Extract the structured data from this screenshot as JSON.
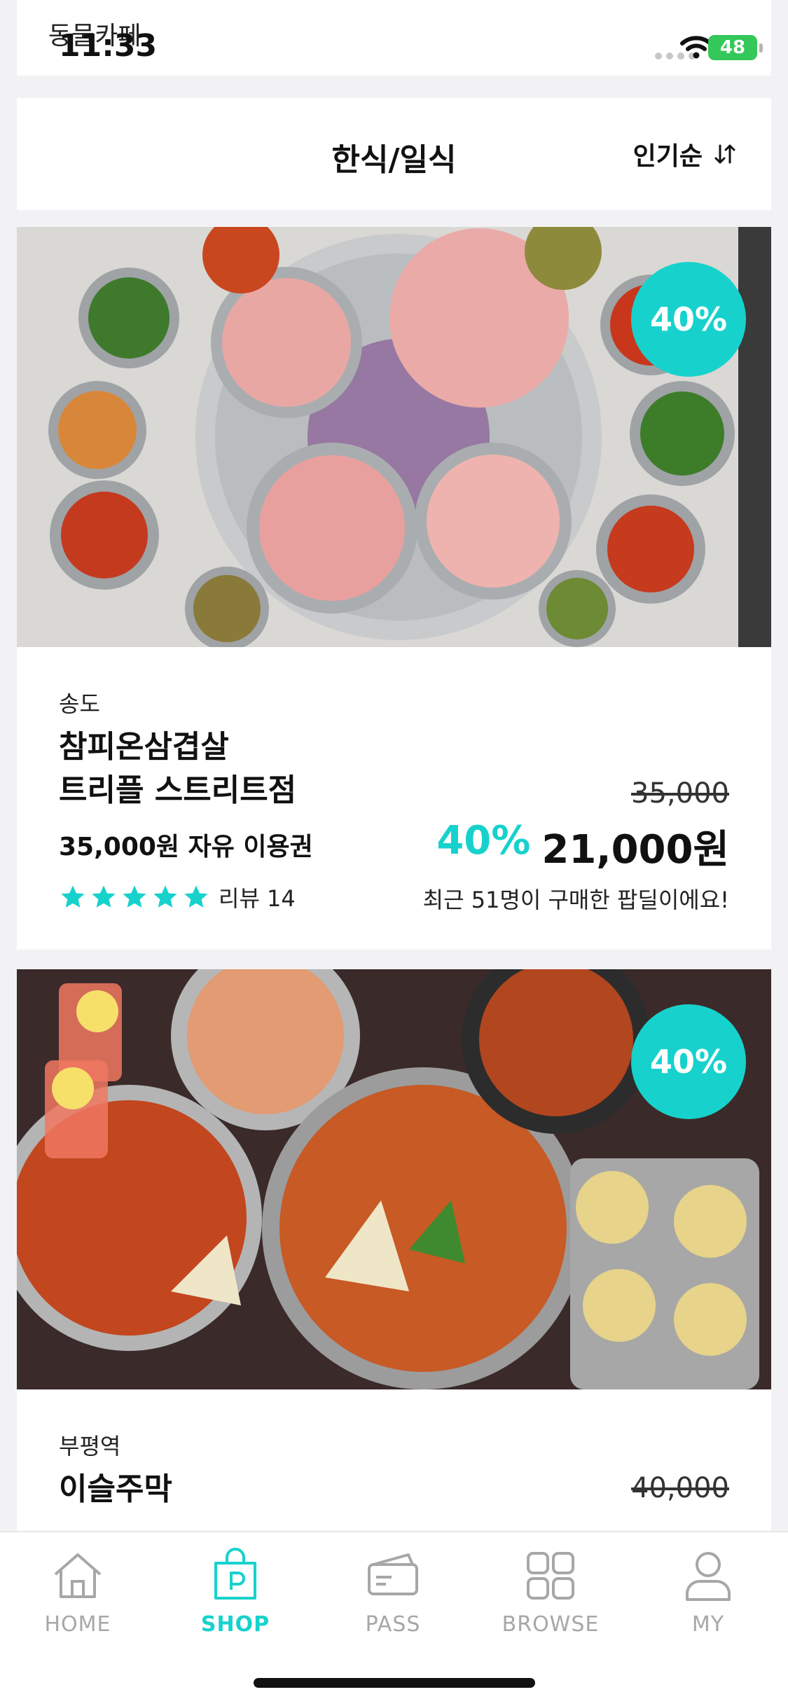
{
  "status_bar": {
    "back_label": "동물카페",
    "time": "11:33",
    "battery": "48"
  },
  "header": {
    "title": "한식/일식",
    "sort_label": "인기순"
  },
  "accent_color": "#17d2cc",
  "deals": [
    {
      "discount_badge": "40%",
      "region": "송도",
      "name_line1": "참피온삼겹살",
      "name_line2": "트리플 스트리트점",
      "voucher": "35,000원 자유 이용권",
      "original_price": "35,000",
      "discount": "40%",
      "sale_price": "21,000원",
      "rating_stars": 5,
      "review": "리뷰 14",
      "buyers": "최근 51명이 구매한 팝딜이에요!"
    },
    {
      "discount_badge": "40%",
      "region": "부평역",
      "name_line1": "이슬주막",
      "original_price": "40,000"
    }
  ],
  "tabs": [
    {
      "label": "HOME",
      "icon": "home-icon"
    },
    {
      "label": "SHOP",
      "icon": "shopping-bag-icon"
    },
    {
      "label": "PASS",
      "icon": "ticket-icon"
    },
    {
      "label": "BROWSE",
      "icon": "grid-icon"
    },
    {
      "label": "MY",
      "icon": "person-icon"
    }
  ]
}
